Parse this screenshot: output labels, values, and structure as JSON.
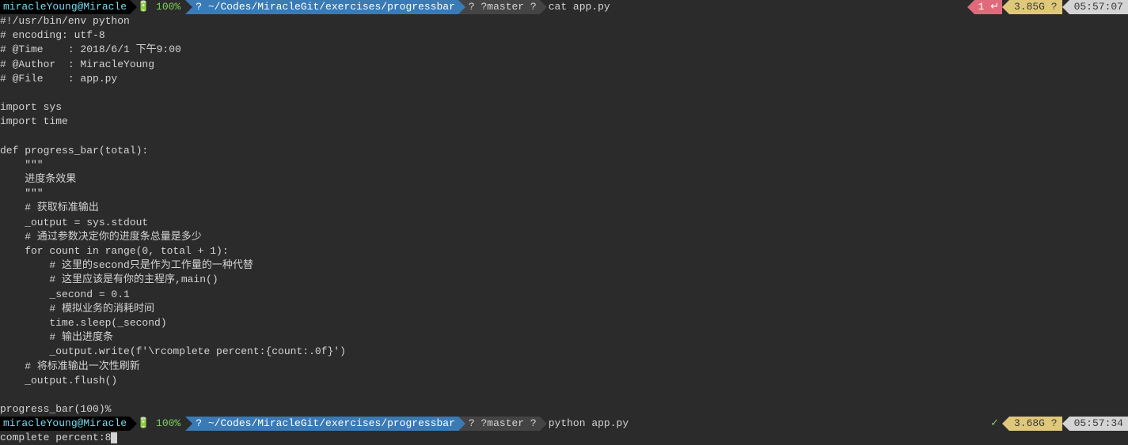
{
  "prompt1": {
    "user": " miracleYoung@Miracle ",
    "battery": "🔋 100%",
    "path": "? ~/Codes/MiracleGit/exercises/progressbar",
    "branch": "? ?master ?",
    "command": "cat app.py",
    "right_count": "1 ↵",
    "right_mem": "3.85G ?",
    "right_time": "05:57:07"
  },
  "code": "#!/usr/bin/env python\n# encoding: utf-8\n# @Time    : 2018/6/1 下午9:00\n# @Author  : MiracleYoung\n# @File    : app.py\n\nimport sys\nimport time\n\ndef progress_bar(total):\n    \"\"\"\n    进度条效果\n    \"\"\"\n    # 获取标准输出\n    _output = sys.stdout\n    # 通过参数决定你的进度条总量是多少\n    for count in range(0, total + 1):\n        # 这里的second只是作为工作量的一种代替\n        # 这里应该是有你的主程序,main()\n        _second = 0.1\n        # 模拟业务的消耗时间\n        time.sleep(_second)\n        # 输出进度条\n        _output.write(f'\\rcomplete percent:{count:.0f}')\n    # 将标准输出一次性刷新\n    _output.flush()\n\nprogress_bar(100)%",
  "prompt2": {
    "user": " miracleYoung@Miracle ",
    "battery": "🔋 100%",
    "path": "? ~/Codes/MiracleGit/exercises/progressbar",
    "branch": "? ?master ?",
    "command": "python app.py",
    "right_check": "✓",
    "right_mem": "3.68G ?",
    "right_time": "05:57:34"
  },
  "output2": "complete percent:8"
}
